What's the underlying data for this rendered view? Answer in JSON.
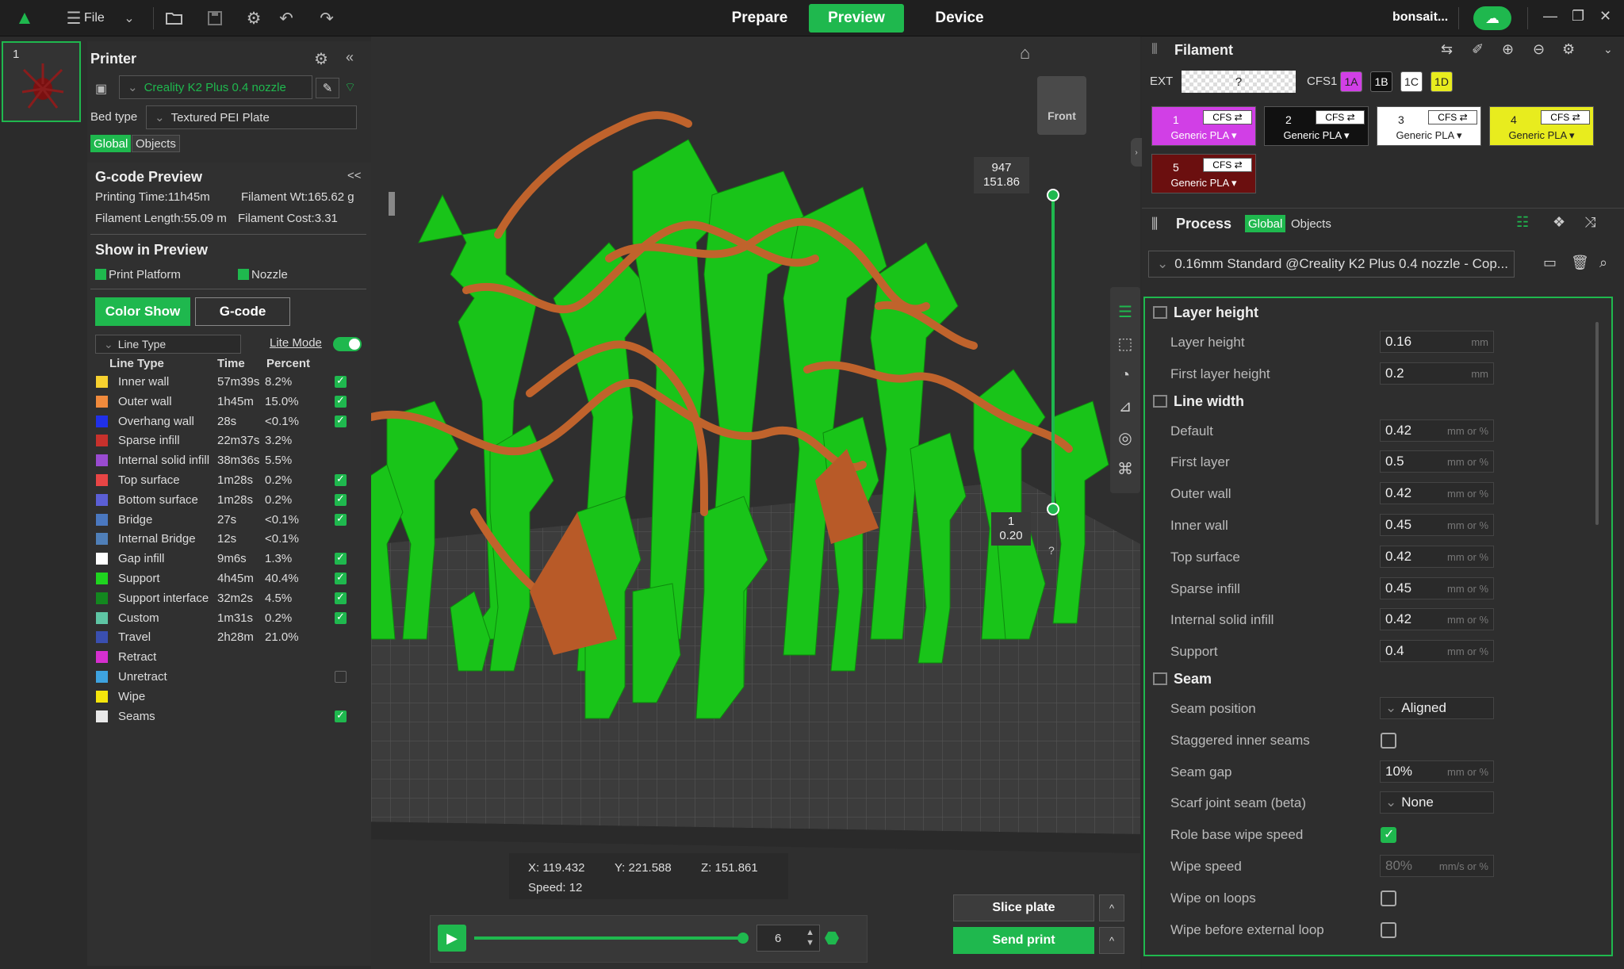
{
  "topbar": {
    "file_label": "File",
    "tabs": [
      "Prepare",
      "Preview",
      "Device"
    ],
    "active_tab": "Preview",
    "user": "bonsait..."
  },
  "plate_number": "1",
  "printer": {
    "title": "Printer",
    "name": "Creality K2 Plus 0.4 nozzle",
    "bed_type_label": "Bed type",
    "bed_type": "Textured PEI Plate",
    "scope_tabs": [
      "Global",
      "Objects"
    ]
  },
  "gcode_preview": {
    "title": "G-code Preview",
    "printing_time": "Printing Time:11h45m",
    "filament_wt": "Filament Wt:165.62 g",
    "filament_length": "Filament Length:55.09 m",
    "filament_cost": "Filament Cost:3.31",
    "show_title": "Show in Preview",
    "print_platform": "Print Platform",
    "nozzle": "Nozzle",
    "color_show": "Color Show",
    "gcode_btn": "G-code",
    "view_select": "Line Type",
    "lite_mode": "Lite Mode",
    "headers": [
      "Line Type",
      "Time",
      "Percent"
    ],
    "rows": [
      {
        "name": "Inner wall",
        "time": "57m39s",
        "pct": "8.2%",
        "color": "#f7d12f",
        "checked": true
      },
      {
        "name": "Outer wall",
        "time": "1h45m",
        "pct": "15.0%",
        "color": "#f08a3c",
        "checked": true
      },
      {
        "name": "Overhang wall",
        "time": "28s",
        "pct": "<0.1%",
        "color": "#2030e8",
        "checked": true
      },
      {
        "name": "Sparse infill",
        "time": "22m37s",
        "pct": "3.2%",
        "color": "#c8312c",
        "checked": false
      },
      {
        "name": "Internal solid infill",
        "time": "38m36s",
        "pct": "5.5%",
        "color": "#9a4bd1",
        "checked": false
      },
      {
        "name": "Top surface",
        "time": "1m28s",
        "pct": "0.2%",
        "color": "#e84545",
        "checked": true
      },
      {
        "name": "Bottom surface",
        "time": "1m28s",
        "pct": "0.2%",
        "color": "#5b5fd6",
        "checked": true
      },
      {
        "name": "Bridge",
        "time": "27s",
        "pct": "<0.1%",
        "color": "#4a78c0",
        "checked": true
      },
      {
        "name": "Internal Bridge",
        "time": "12s",
        "pct": "<0.1%",
        "color": "#4f7fb8",
        "checked": false
      },
      {
        "name": "Gap infill",
        "time": "9m6s",
        "pct": "1.3%",
        "color": "#ffffff",
        "checked": true
      },
      {
        "name": "Support",
        "time": "4h45m",
        "pct": "40.4%",
        "color": "#1fd41f",
        "checked": true
      },
      {
        "name": "Support interface",
        "time": "32m2s",
        "pct": "4.5%",
        "color": "#13871f",
        "checked": true
      },
      {
        "name": "Custom",
        "time": "1m31s",
        "pct": "0.2%",
        "color": "#5ec5a4",
        "checked": true
      },
      {
        "name": "Travel",
        "time": "2h28m",
        "pct": "21.0%",
        "color": "#3a4fb0",
        "checked": false
      },
      {
        "name": "Retract",
        "time": "",
        "pct": "",
        "color": "#d62fcf",
        "checked": false
      },
      {
        "name": "Unretract",
        "time": "",
        "pct": "",
        "color": "#3ea3e0",
        "checked": false
      },
      {
        "name": "Wipe",
        "time": "",
        "pct": "",
        "color": "#f5e50c",
        "checked": false
      },
      {
        "name": "Seams",
        "time": "",
        "pct": "",
        "color": "#e8e8e8",
        "checked": true
      }
    ]
  },
  "viewport": {
    "view_label": "Front",
    "layer_top": "947",
    "height_top": "151.86",
    "layer_bottom": "1",
    "height_bottom": "0.20",
    "coord_x": "X: 119.432",
    "coord_y": "Y: 221.588",
    "coord_z": "Z: 151.861",
    "speed": "Speed: 12",
    "move_value": "6",
    "slider_fraction": 0.99,
    "slice_label": "Slice plate",
    "send_label": "Send print"
  },
  "filament": {
    "title": "Filament",
    "ext_label": "EXT",
    "ext_value": "?",
    "cfs_label": "CFS1",
    "cfs_slots": [
      {
        "label": "1A",
        "color": "#d13fe6"
      },
      {
        "label": "1B",
        "color": "#111111"
      },
      {
        "label": "1C",
        "color": "#ffffff"
      },
      {
        "label": "1D",
        "color": "#e8ec1e"
      }
    ],
    "items": [
      {
        "num": "1",
        "cfs": "CFS ⇄",
        "name": "Generic PLA ▾",
        "color": "#d13fe6",
        "fg": "#ffffff"
      },
      {
        "num": "2",
        "cfs": "CFS ⇄",
        "name": "Generic PLA ▾",
        "color": "#111111",
        "fg": "#ffffff"
      },
      {
        "num": "3",
        "cfs": "CFS ⇄",
        "name": "Generic PLA ▾",
        "color": "#ffffff",
        "fg": "#222222"
      },
      {
        "num": "4",
        "cfs": "CFS ⇄",
        "name": "Generic PLA ▾",
        "color": "#e8ec1e",
        "fg": "#222222"
      },
      {
        "num": "5",
        "cfs": "CFS ⇄",
        "name": "Generic PLA ▾",
        "color": "#6b0f0f",
        "fg": "#ffffff"
      }
    ]
  },
  "process": {
    "title": "Process",
    "scope_tabs": [
      "Global",
      "Objects"
    ],
    "preset": "0.16mm Standard @Creality K2 Plus 0.4 nozzle - Cop...",
    "groups": [
      {
        "title": "Layer height",
        "params": [
          {
            "label": "Layer height",
            "value": "0.16",
            "unit": "mm"
          },
          {
            "label": "First layer height",
            "value": "0.2",
            "unit": "mm"
          }
        ]
      },
      {
        "title": "Line width",
        "params": [
          {
            "label": "Default",
            "value": "0.42",
            "unit": "mm or %"
          },
          {
            "label": "First layer",
            "value": "0.5",
            "unit": "mm or %"
          },
          {
            "label": "Outer wall",
            "value": "0.42",
            "unit": "mm or %"
          },
          {
            "label": "Inner wall",
            "value": "0.45",
            "unit": "mm or %"
          },
          {
            "label": "Top surface",
            "value": "0.42",
            "unit": "mm or %"
          },
          {
            "label": "Sparse infill",
            "value": "0.45",
            "unit": "mm or %"
          },
          {
            "label": "Internal solid infill",
            "value": "0.42",
            "unit": "mm or %"
          },
          {
            "label": "Support",
            "value": "0.4",
            "unit": "mm or %"
          }
        ]
      },
      {
        "title": "Seam",
        "params": [
          {
            "label": "Seam position",
            "value": "Aligned",
            "type": "select"
          },
          {
            "label": "Staggered inner seams",
            "type": "check",
            "checked": false
          },
          {
            "label": "Seam gap",
            "value": "10%",
            "unit": "mm or %"
          },
          {
            "label": "Scarf joint seam (beta)",
            "value": "None",
            "type": "select"
          },
          {
            "label": "Role base wipe speed",
            "type": "check",
            "checked": true
          },
          {
            "label": "Wipe speed",
            "value": "80%",
            "unit": "mm/s or %"
          },
          {
            "label": "Wipe on loops",
            "type": "check",
            "checked": false
          },
          {
            "label": "Wipe before external loop",
            "type": "check",
            "checked": false
          }
        ]
      }
    ]
  }
}
